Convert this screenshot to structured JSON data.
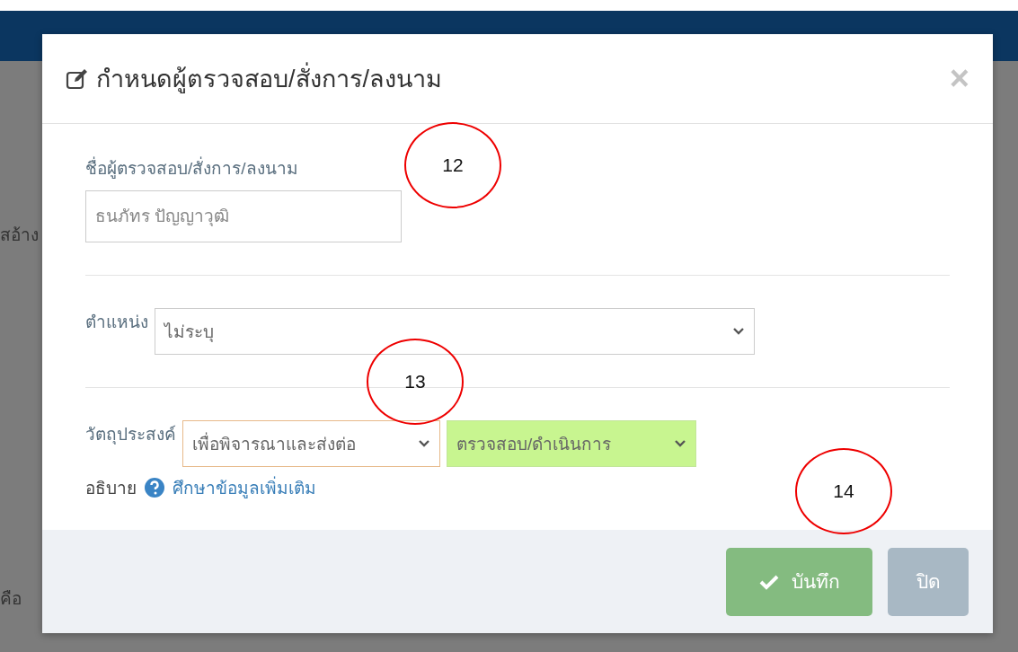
{
  "background": {
    "fragments": [
      "สอ้าง",
      "คือ"
    ]
  },
  "modal": {
    "title": "กำหนดผู้ตรวจสอบ/สั่งการ/ลงนาม",
    "close": "×",
    "name_field": {
      "label": "ชื่อผู้ตรวจสอบ/สั่งการ/ลงนาม",
      "placeholder": "ธนภัทร ปัญญาวุฒิ"
    },
    "position": {
      "label": "ตำแหน่ง",
      "value": "ไม่ระบุ"
    },
    "purpose": {
      "label": "วัตถุประสงค์",
      "selects": [
        {
          "value": "เพื่อพิจารณาและส่งต่อ",
          "kind": "outlined"
        },
        {
          "value": "ตรวจสอบ/ดำเนินการ",
          "kind": "filled"
        }
      ]
    },
    "explain": {
      "label": "อธิบาย",
      "link": "ศึกษาข้อมูลเพิ่มเติม"
    },
    "buttons": [
      {
        "label": "บันทึก",
        "kind": "save"
      },
      {
        "label": "ปิด",
        "kind": "close"
      }
    ]
  },
  "annotations": [
    "12",
    "13",
    "14"
  ]
}
